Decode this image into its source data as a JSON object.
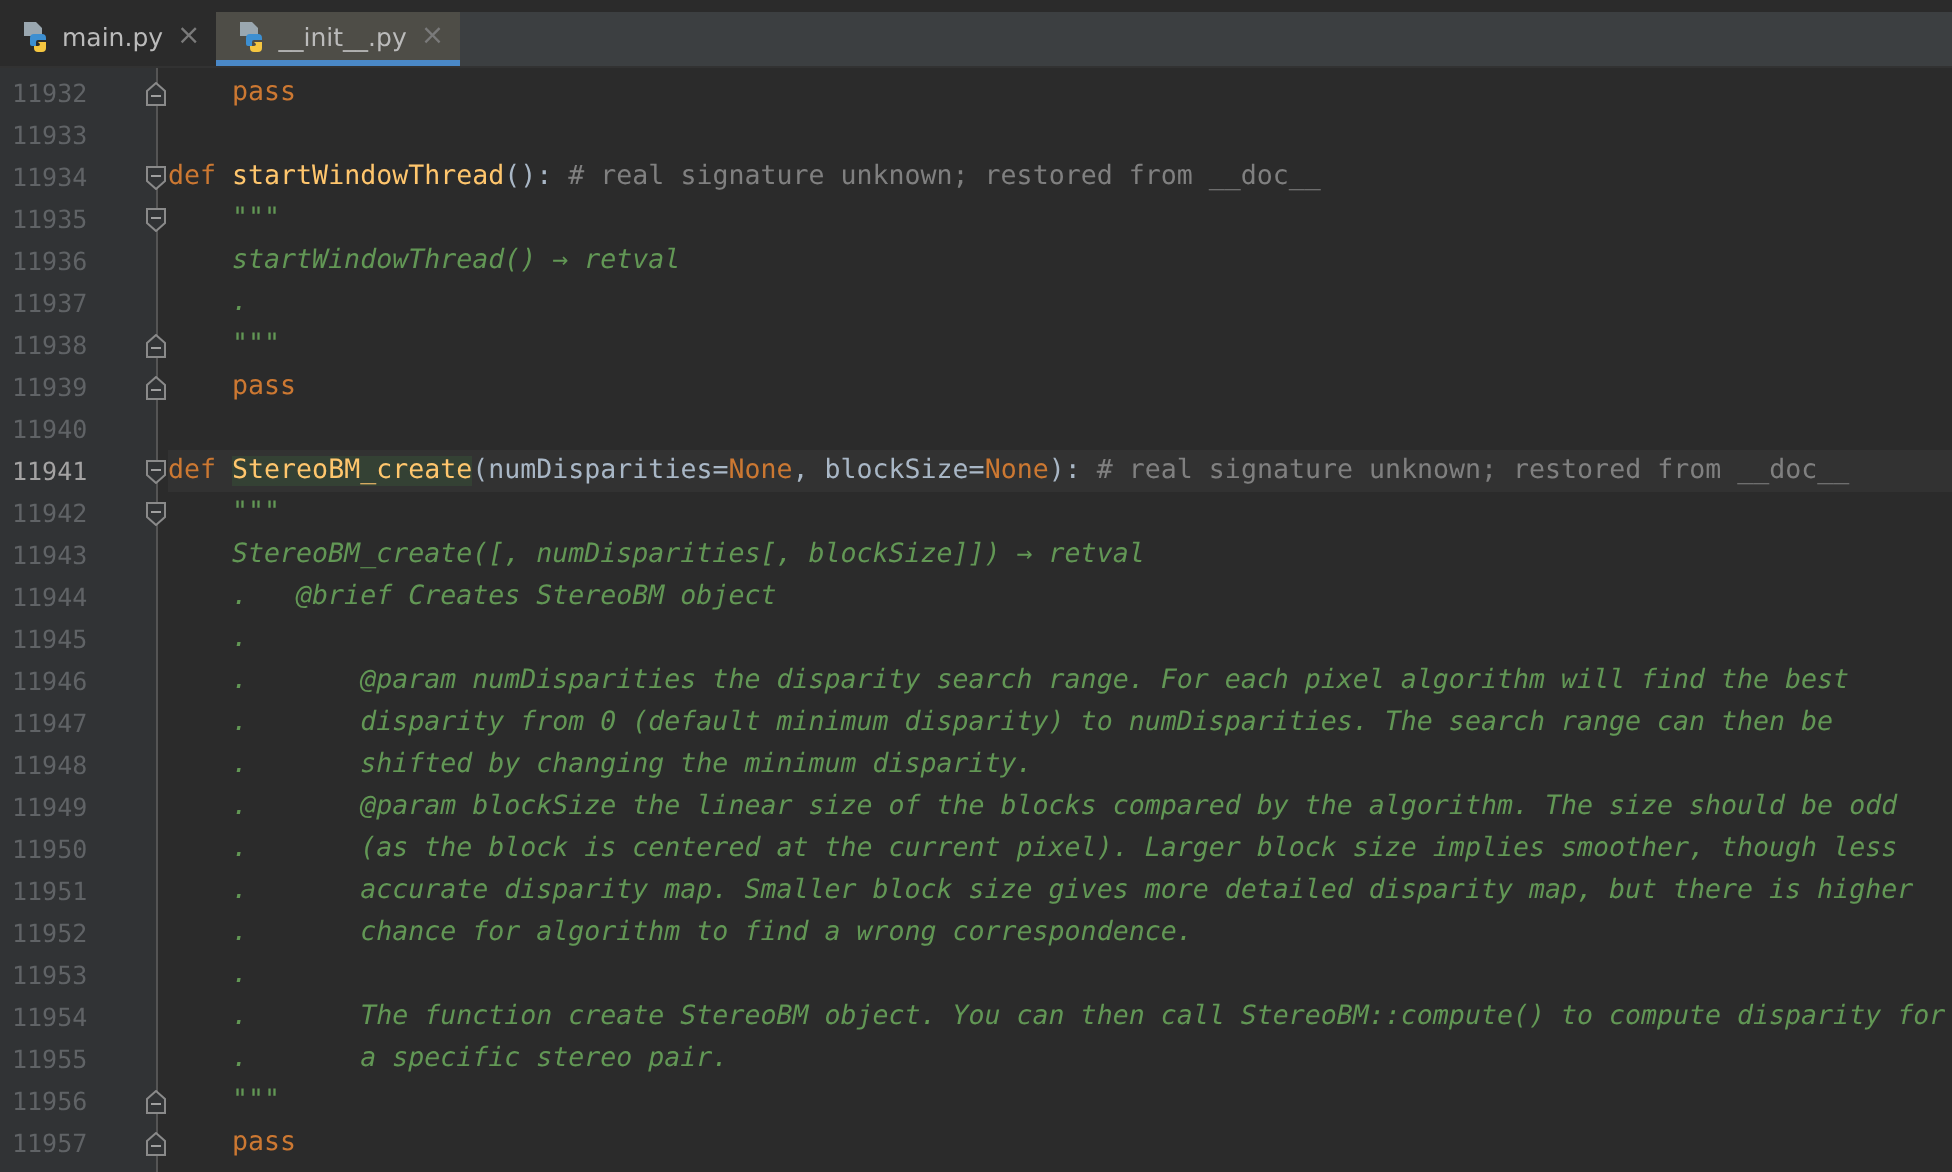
{
  "tabs": [
    {
      "label": "main.py",
      "selected": false,
      "close": "×"
    },
    {
      "label": "__init__.py",
      "selected": true,
      "close": "×"
    }
  ],
  "editor": {
    "lines": [
      {
        "number": "11932",
        "current": false,
        "fold_start": false,
        "fold_end": true,
        "tokens": [
          {
            "kind": "keyword",
            "text": "    pass"
          }
        ]
      },
      {
        "number": "11933",
        "current": false,
        "fold_start": false,
        "fold_end": false
      },
      {
        "number": "11934",
        "current": false,
        "fold_start": true,
        "fold_end": false,
        "tokens": [
          {
            "kind": "keyword",
            "text": "def "
          },
          {
            "kind": "function",
            "text": "startWindowThread"
          },
          {
            "kind": "plain",
            "text": "(): "
          },
          {
            "kind": "comment",
            "text": "# real signature unknown; restored from __doc__"
          }
        ]
      },
      {
        "number": "11935",
        "current": false,
        "fold_start": true,
        "fold_end": false,
        "tokens": [
          {
            "kind": "docstring",
            "text": "    \"\"\""
          }
        ]
      },
      {
        "number": "11936",
        "current": false,
        "fold_start": false,
        "fold_end": false,
        "tokens": [
          {
            "kind": "docstring",
            "text": "    startWindowThread() → retval"
          }
        ]
      },
      {
        "number": "11937",
        "current": false,
        "fold_start": false,
        "fold_end": false,
        "tokens": [
          {
            "kind": "docstring",
            "text": "    ."
          }
        ]
      },
      {
        "number": "11938",
        "current": false,
        "fold_start": false,
        "fold_end": true,
        "tokens": [
          {
            "kind": "docstring",
            "text": "    \"\"\""
          }
        ]
      },
      {
        "number": "11939",
        "current": false,
        "fold_start": false,
        "fold_end": true,
        "tokens": [
          {
            "kind": "keyword",
            "text": "    pass"
          }
        ]
      },
      {
        "number": "11940",
        "current": false,
        "fold_start": false,
        "fold_end": false
      },
      {
        "number": "11941",
        "current": true,
        "fold_start": true,
        "fold_end": false,
        "tokens": [
          {
            "kind": "keyword",
            "text": "def "
          },
          {
            "kind": "match",
            "text": "StereoBM_create"
          },
          {
            "kind": "plain",
            "text": "(numDisparities="
          },
          {
            "kind": "keyword",
            "text": "None"
          },
          {
            "kind": "plain",
            "text": ", blockSize="
          },
          {
            "kind": "keyword",
            "text": "None"
          },
          {
            "kind": "plain",
            "text": "): "
          },
          {
            "kind": "comment",
            "text": "# real signature unknown; restored from __doc__"
          }
        ]
      },
      {
        "number": "11942",
        "current": false,
        "fold_start": true,
        "fold_end": false,
        "tokens": [
          {
            "kind": "docstring",
            "text": "    \"\"\""
          }
        ]
      },
      {
        "number": "11943",
        "current": false,
        "fold_start": false,
        "fold_end": false,
        "tokens": [
          {
            "kind": "docstring",
            "text": "    StereoBM_create([, numDisparities[, blockSize]]) → retval"
          }
        ]
      },
      {
        "number": "11944",
        "current": false,
        "fold_start": false,
        "fold_end": false,
        "tokens": [
          {
            "kind": "docstring",
            "text": "    .   @brief Creates StereoBM object"
          }
        ]
      },
      {
        "number": "11945",
        "current": false,
        "fold_start": false,
        "fold_end": false,
        "tokens": [
          {
            "kind": "docstring",
            "text": "    ."
          }
        ]
      },
      {
        "number": "11946",
        "current": false,
        "fold_start": false,
        "fold_end": false,
        "tokens": [
          {
            "kind": "docstring",
            "text": "    .       @param numDisparities the disparity search range. For each pixel algorithm will find the best"
          }
        ]
      },
      {
        "number": "11947",
        "current": false,
        "fold_start": false,
        "fold_end": false,
        "tokens": [
          {
            "kind": "docstring",
            "text": "    .       disparity from 0 (default minimum disparity) to numDisparities. The search range can then be"
          }
        ]
      },
      {
        "number": "11948",
        "current": false,
        "fold_start": false,
        "fold_end": false,
        "tokens": [
          {
            "kind": "docstring",
            "text": "    .       shifted by changing the minimum disparity."
          }
        ]
      },
      {
        "number": "11949",
        "current": false,
        "fold_start": false,
        "fold_end": false,
        "tokens": [
          {
            "kind": "docstring",
            "text": "    .       @param blockSize the linear size of the blocks compared by the algorithm. The size should be odd"
          }
        ]
      },
      {
        "number": "11950",
        "current": false,
        "fold_start": false,
        "fold_end": false,
        "tokens": [
          {
            "kind": "docstring",
            "text": "    .       (as the block is centered at the current pixel). Larger block size implies smoother, though less"
          }
        ]
      },
      {
        "number": "11951",
        "current": false,
        "fold_start": false,
        "fold_end": false,
        "tokens": [
          {
            "kind": "docstring",
            "text": "    .       accurate disparity map. Smaller block size gives more detailed disparity map, but there is higher"
          }
        ]
      },
      {
        "number": "11952",
        "current": false,
        "fold_start": false,
        "fold_end": false,
        "tokens": [
          {
            "kind": "docstring",
            "text": "    .       chance for algorithm to find a wrong correspondence."
          }
        ]
      },
      {
        "number": "11953",
        "current": false,
        "fold_start": false,
        "fold_end": false,
        "tokens": [
          {
            "kind": "docstring",
            "text": "    ."
          }
        ]
      },
      {
        "number": "11954",
        "current": false,
        "fold_start": false,
        "fold_end": false,
        "tokens": [
          {
            "kind": "docstring",
            "text": "    .       The function create StereoBM object. You can then call StereoBM::compute() to compute disparity for"
          }
        ]
      },
      {
        "number": "11955",
        "current": false,
        "fold_start": false,
        "fold_end": false,
        "tokens": [
          {
            "kind": "docstring",
            "text": "    .       a specific stereo pair."
          }
        ]
      },
      {
        "number": "11956",
        "current": false,
        "fold_start": false,
        "fold_end": true,
        "tokens": [
          {
            "kind": "docstring",
            "text": "    \"\"\""
          }
        ]
      },
      {
        "number": "11957",
        "current": false,
        "fold_start": false,
        "fold_end": true,
        "tokens": [
          {
            "kind": "keyword",
            "text": "    pass"
          }
        ]
      }
    ]
  }
}
